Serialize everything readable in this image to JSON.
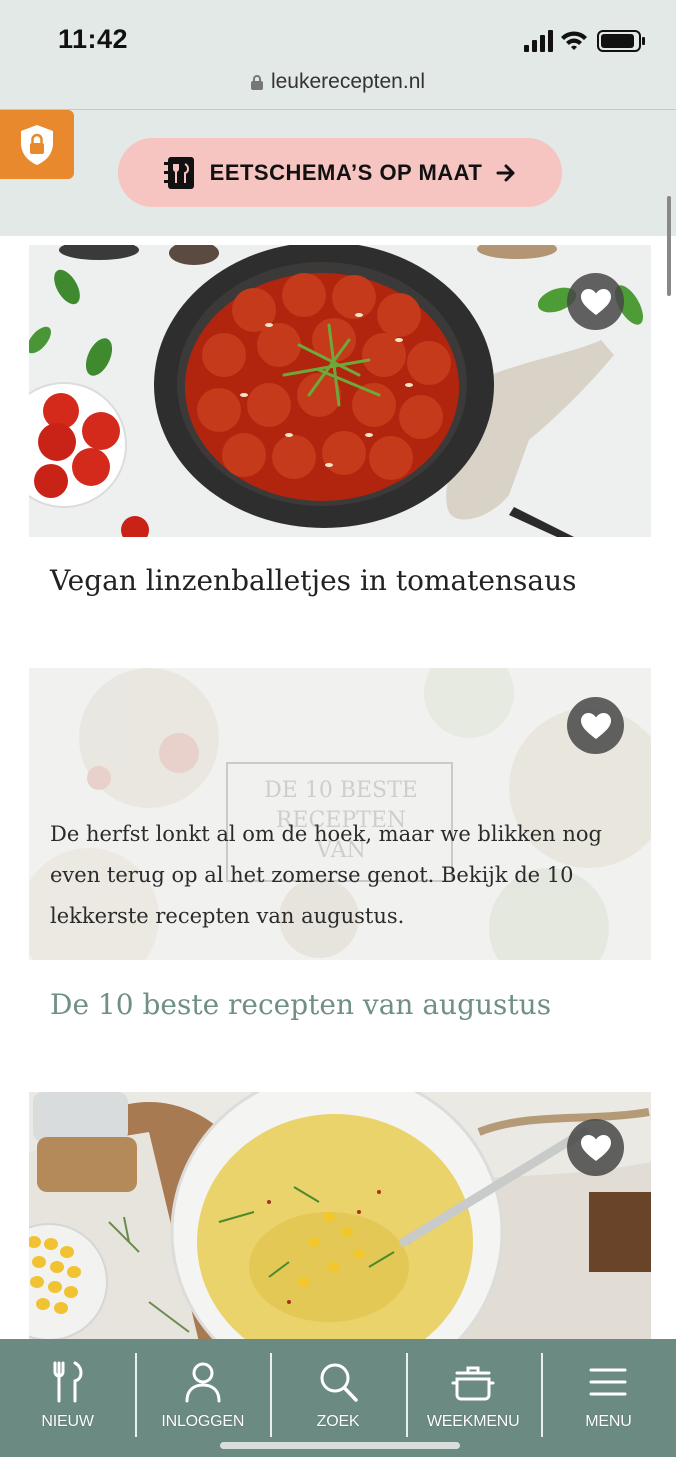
{
  "status_bar": {
    "time": "11:42"
  },
  "browser": {
    "url": "leukerecepten.nl"
  },
  "header": {
    "promo_label": "EETSCHEMA’S OP MAAT"
  },
  "cards": [
    {
      "title": "Vegan linzenballetjes in tomatensaus",
      "image": "meatballs-in-tomato-sauce-skillet"
    },
    {
      "overlay_text": "DE 10 BESTE RECEPTEN VAN",
      "teaser": "De herfst lonkt al om de hoek, maar we blikken nog even terug op al het zomerse genot. Bekijk de 10 lekkerste recepten van augustus.",
      "title": "De 10 beste recepten van augustus",
      "title_color": "#6f8f87"
    },
    {
      "image": "yellow-corn-soup-bowl"
    }
  ],
  "bottom_nav": [
    {
      "label": "NIEUW",
      "icon": "fork-knife-icon"
    },
    {
      "label": "INLOGGEN",
      "icon": "user-icon"
    },
    {
      "label": "ZOEK",
      "icon": "search-icon"
    },
    {
      "label": "WEEKMENU",
      "icon": "pot-icon"
    },
    {
      "label": "MENU",
      "icon": "hamburger-icon"
    }
  ],
  "colors": {
    "promo_bg": "#f6c4c1",
    "privacy_bg": "#e8892e",
    "nav_bg": "#6b8a82",
    "topbar_bg": "#e3e9e7"
  }
}
